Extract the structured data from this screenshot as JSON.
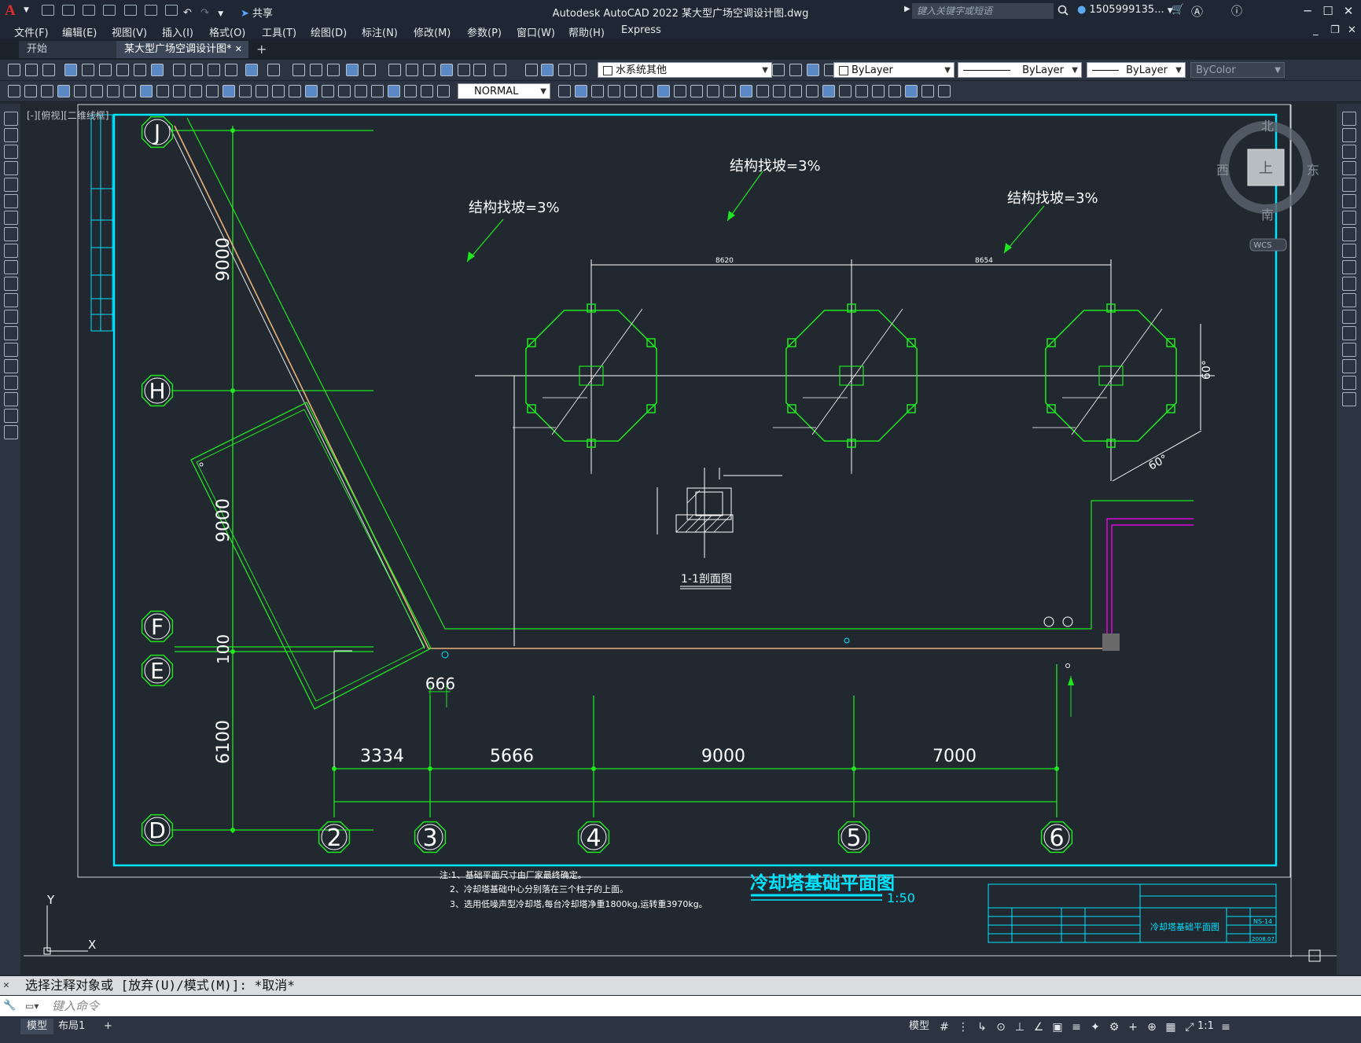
{
  "app": {
    "logo_letter": "A",
    "title": "Autodesk AutoCAD 2022    某大型广场空调设计图.dwg",
    "share_label": "共享",
    "search_placeholder": "键入关键字或短语",
    "user": "1505999135...",
    "help": "?"
  },
  "menu": [
    "文件(F)",
    "编辑(E)",
    "视图(V)",
    "插入(I)",
    "格式(O)",
    "工具(T)",
    "绘图(D)",
    "标注(N)",
    "修改(M)",
    "参数(P)",
    "窗口(W)",
    "帮助(H)",
    "Express"
  ],
  "tabs": {
    "start": "开始",
    "drawing": "某大型广场空调设计图*",
    "close": "✕",
    "add": "+"
  },
  "toolbar": {
    "layer_name": "水系统其他",
    "color_combo": "ByLayer",
    "linetype_combo": "ByLayer",
    "lineweight_combo": "ByLayer",
    "plotstyle_combo": "ByColor",
    "dimstyle_combo": "NORMAL"
  },
  "viewport_label": "[-][俯视][二维线框]",
  "viewcube": {
    "north": "北",
    "south": "南",
    "east": "东",
    "west": "西",
    "top": "上",
    "wcs": "WCS"
  },
  "ucs": {
    "x": "X",
    "y": "Y"
  },
  "drawing": {
    "grid_row_labels": [
      "J",
      "H",
      "F",
      "E",
      "D"
    ],
    "grid_col_labels": [
      "2",
      "3",
      "4",
      "5",
      "6"
    ],
    "vert_dims": [
      "9000",
      "9000",
      "100",
      "6100"
    ],
    "horiz_dims": [
      "3334",
      "5666",
      "9000",
      "7000"
    ],
    "small_dim": "666",
    "slope_labels": [
      "结构找坡=3%",
      "结构找坡=3%",
      "结构找坡=3%"
    ],
    "top_dims": [
      "8620",
      "8654"
    ],
    "angle_labels": [
      "60°",
      "60°"
    ],
    "section_title": "1-1剖面图",
    "plan_title": "冷却塔基础平面图",
    "plan_scale": "1:50",
    "notes": [
      "注:1、基础平面尺寸由厂家最终确定。",
      "2、冷却塔基础中心分别落在三个柱子的上面。",
      "3、选用低噪声型冷却塔,每台冷却塔净重1800kg,运转重3970kg。"
    ],
    "titleblock_name": "冷却塔基础平面图",
    "titleblock_no": "NS-14",
    "titleblock_date": "2008.07"
  },
  "command": {
    "history": "选择注释对象或 [放弃(U)/模式(M)]: *取消*",
    "prompt_placeholder": "键入命令"
  },
  "status": {
    "tab_model": "模型",
    "tab_layout": "布局1",
    "tab_add": "+",
    "model_label": "模型",
    "scale": "1:1"
  }
}
